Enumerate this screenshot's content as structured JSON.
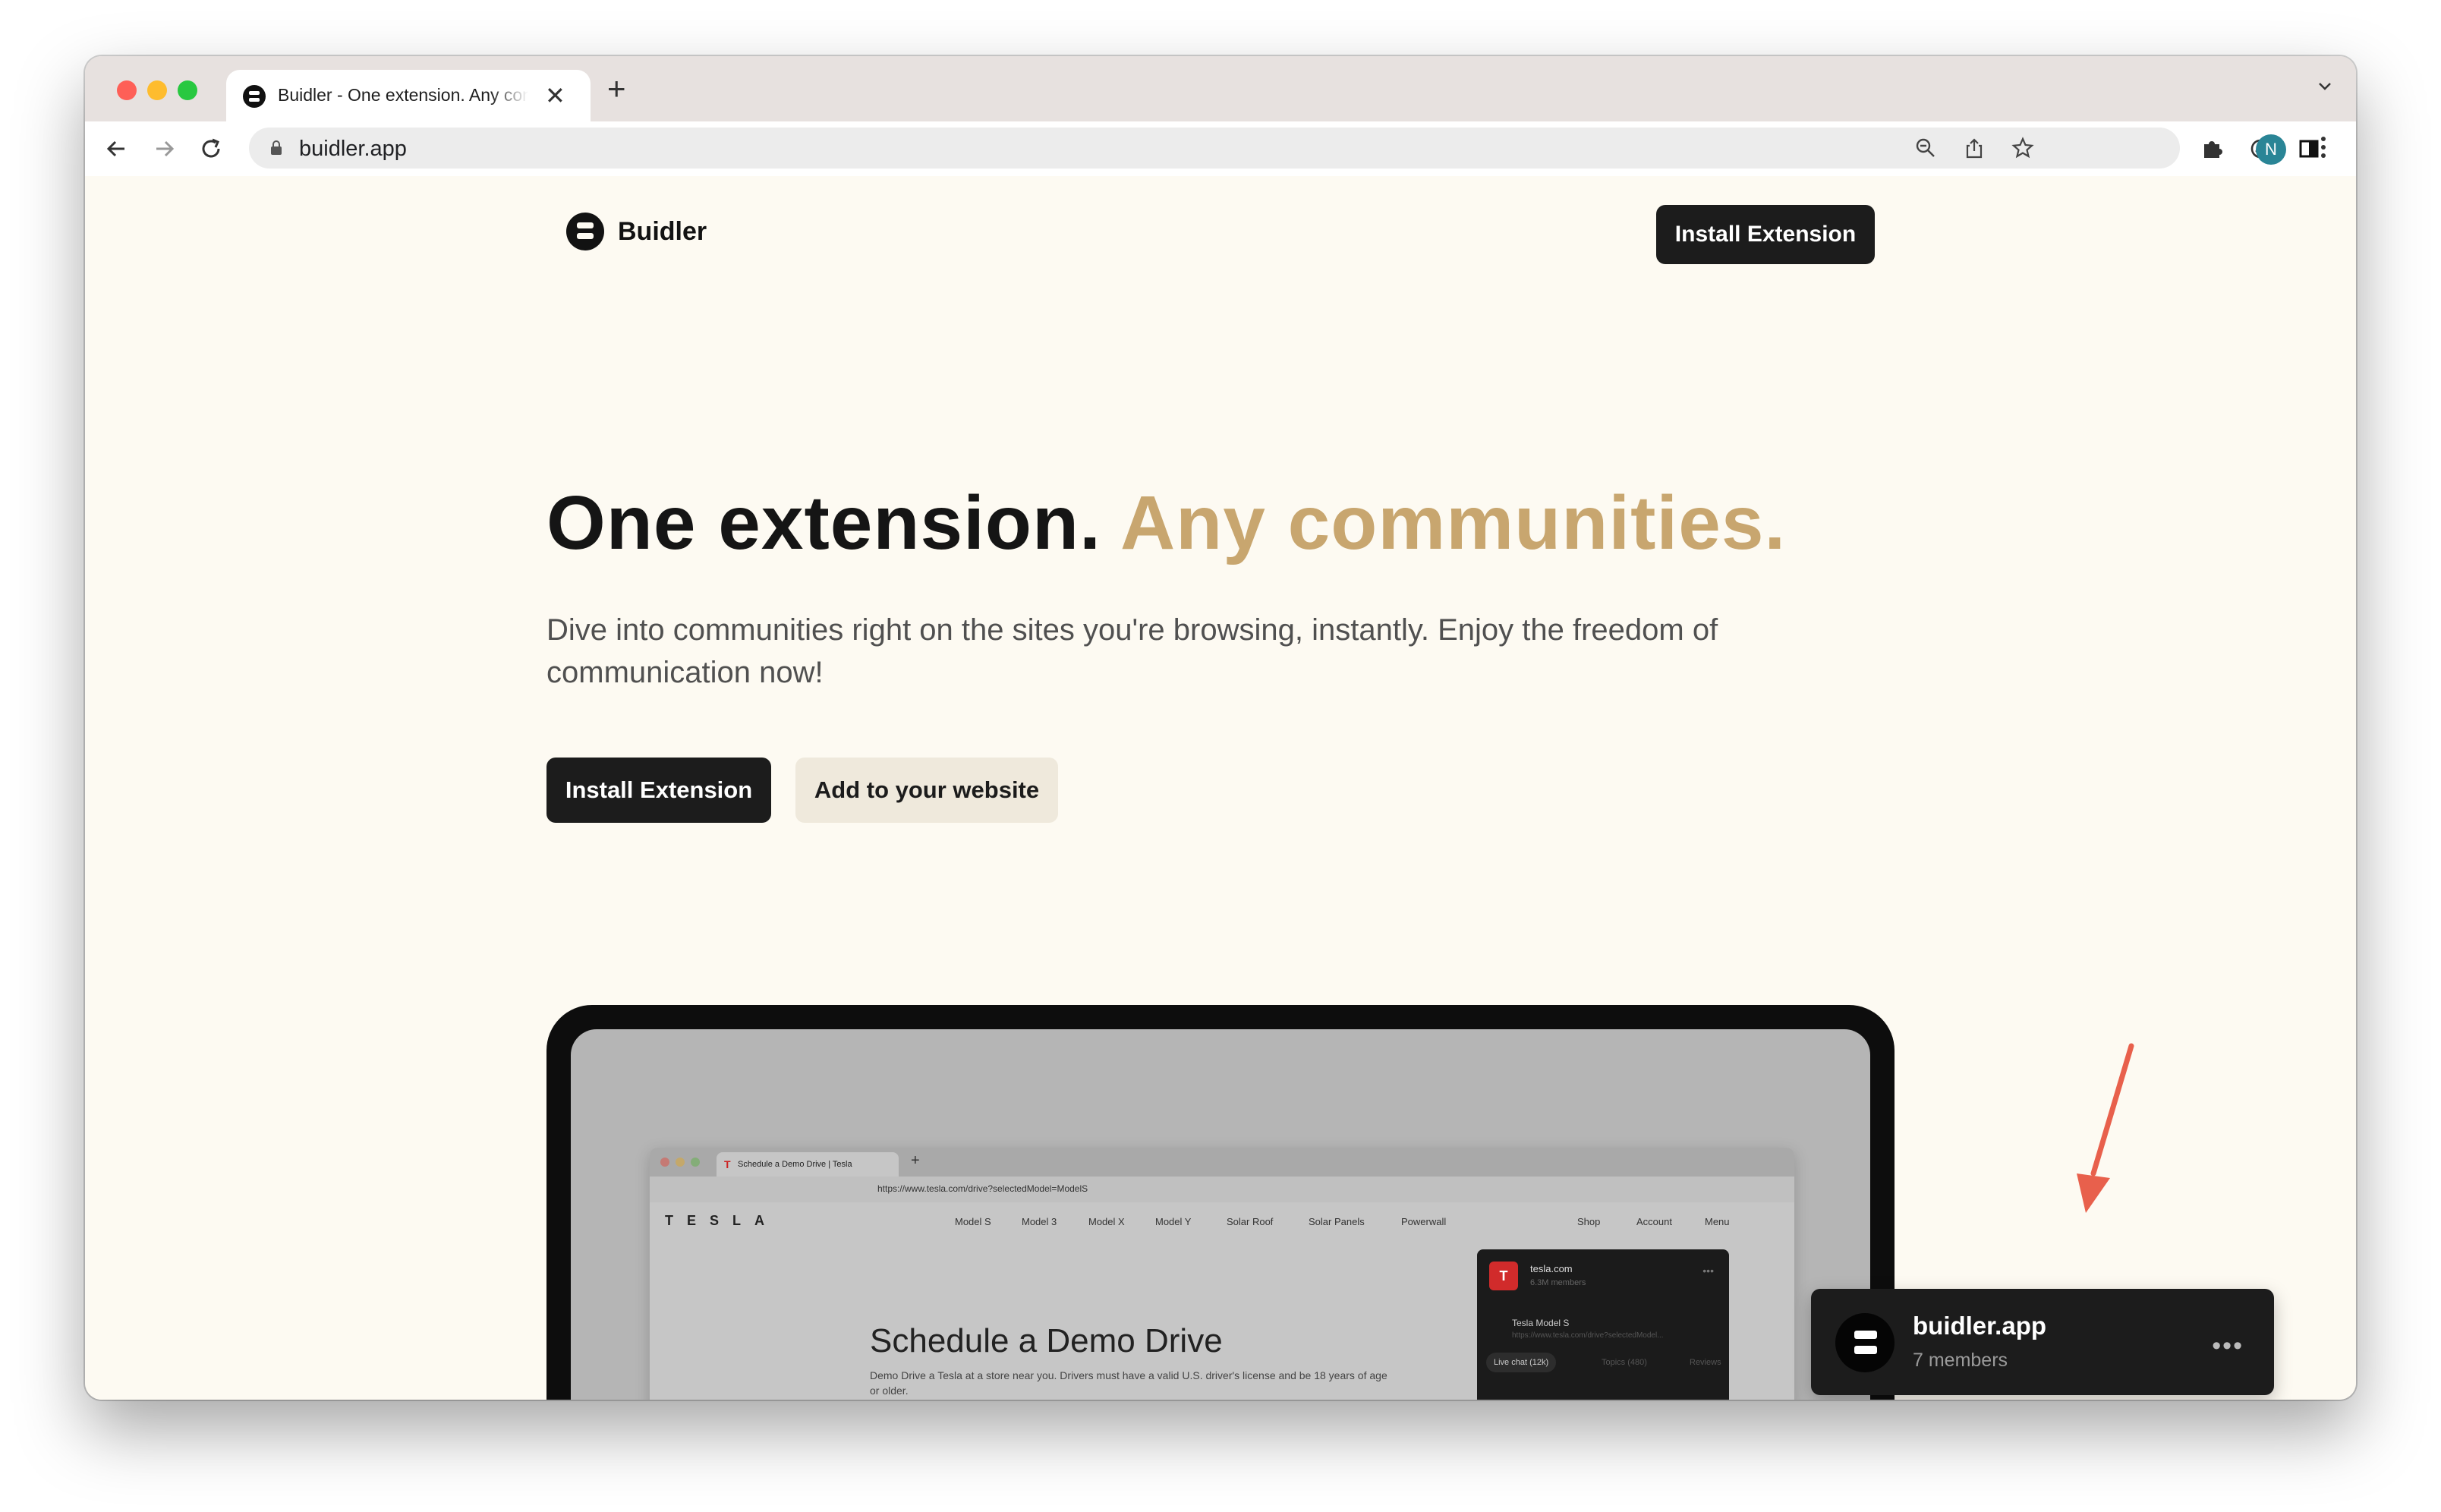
{
  "browser": {
    "tab_title": "Buidler - One extension. Any communities.",
    "url": "buidler.app",
    "avatar_letter": "N"
  },
  "nav": {
    "logo_text": "Buidler",
    "install_label": "Install Extension"
  },
  "hero": {
    "title_main": "One extension.",
    "title_accent": "Any communities.",
    "subtitle": "Dive into communities right on the sites you're browsing, instantly. Enjoy the freedom of communication now!",
    "install_label": "Install Extension",
    "add_label": "Add to your website"
  },
  "mockup": {
    "tab_title": "Schedule a Demo Drive | Tesla",
    "url": "https://www.tesla.com/drive?selectedModel=ModelS",
    "brand": "TESLA",
    "menu": [
      "Model S",
      "Model 3",
      "Model X",
      "Model Y",
      "Solar Roof",
      "Solar Panels",
      "Powerwall"
    ],
    "menu_right": [
      "Shop",
      "Account",
      "Menu"
    ],
    "headline": "Schedule a Demo Drive",
    "description": "Demo Drive a Tesla at a store near you. Drivers must have a valid U.S. driver's license and be 18 years of age",
    "description_2": "or older.",
    "panel_title": "tesla.com",
    "panel_members": "6.3M members",
    "panel_page": "Tesla Model S",
    "panel_url": "https://www.tesla.com/drive?selectedModel...",
    "pill_live": "Live chat (12k)",
    "pill_topics": "Topics (480)",
    "pill_reviews": "Reviews"
  },
  "widget": {
    "title": "buidler.app",
    "members": "7 members",
    "more": "•••"
  },
  "colors": {
    "page_bg": "#fdfaf2",
    "accent": "#c8a66f",
    "dark": "#1c1c1c",
    "secondary_button_bg": "#efe9dc",
    "annotation_arrow": "#e8604c"
  }
}
